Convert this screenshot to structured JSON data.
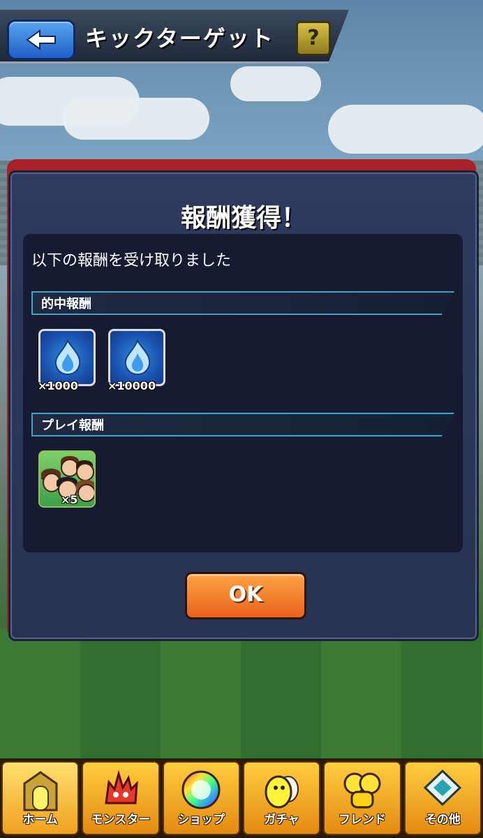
{
  "header": {
    "title": "キックターゲット",
    "help_label": "?"
  },
  "dialog": {
    "title": "報酬獲得！",
    "intro": "以下の報酬を受け取りました",
    "sections": [
      {
        "label": "的中報酬",
        "items": [
          {
            "qty": "×1000",
            "icon": "blue-flame-icon"
          },
          {
            "qty": "×10000",
            "icon": "blue-flame-icon"
          }
        ]
      },
      {
        "label": "プレイ報酬",
        "items": [
          {
            "qty": "×5",
            "icon": "character-group-icon"
          }
        ]
      }
    ],
    "ok_label": "OK"
  },
  "nav": {
    "items": [
      {
        "label": "ホーム",
        "icon": "home-gate-icon"
      },
      {
        "label": "モンスター",
        "icon": "monster-icon"
      },
      {
        "label": "ショップ",
        "icon": "rainbow-orb-icon"
      },
      {
        "label": "ガチャ",
        "icon": "egg-icon"
      },
      {
        "label": "フレンド",
        "icon": "friends-balloon-icon"
      },
      {
        "label": "その他",
        "icon": "other-icon"
      }
    ]
  },
  "colors": {
    "dialog_bg": "#2e3a5e",
    "panel_bg": "#161b31",
    "section_border": "#3aa6c8",
    "ok_button": "#f07a24",
    "nav_gold": "#f5a820"
  }
}
